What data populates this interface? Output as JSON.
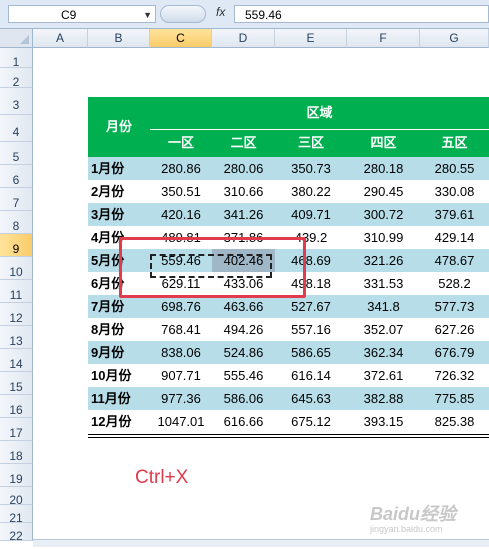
{
  "formula_bar": {
    "name_box": "C9",
    "fx_label": "fx",
    "formula": "559.46"
  },
  "columns": [
    "A",
    "B",
    "C",
    "D",
    "E",
    "F",
    "G"
  ],
  "rows": [
    "1",
    "2",
    "3",
    "4",
    "5",
    "6",
    "7",
    "8",
    "9",
    "10",
    "11",
    "12",
    "13",
    "14",
    "15",
    "16",
    "17",
    "18",
    "19",
    "20",
    "21",
    "22"
  ],
  "selected": {
    "column": "C",
    "row": "9"
  },
  "table": {
    "month_header": "月份",
    "region_header": "区域",
    "regions": [
      "一区",
      "二区",
      "三区",
      "四区",
      "五区"
    ],
    "data": [
      {
        "month": "1月份",
        "values": [
          "280.86",
          "280.06",
          "350.73",
          "280.18",
          "280.55"
        ]
      },
      {
        "month": "2月份",
        "values": [
          "350.51",
          "310.66",
          "380.22",
          "290.45",
          "330.08"
        ]
      },
      {
        "month": "3月份",
        "values": [
          "420.16",
          "341.26",
          "409.71",
          "300.72",
          "379.61"
        ]
      },
      {
        "month": "4月份",
        "values": [
          "489.81",
          "371.86",
          "439.2",
          "310.99",
          "429.14"
        ]
      },
      {
        "month": "5月份",
        "values": [
          "559.46",
          "402.46",
          "468.69",
          "321.26",
          "478.67"
        ]
      },
      {
        "month": "6月份",
        "values": [
          "629.11",
          "433.06",
          "498.18",
          "331.53",
          "528.2"
        ]
      },
      {
        "month": "7月份",
        "values": [
          "698.76",
          "463.66",
          "527.67",
          "341.8",
          "577.73"
        ]
      },
      {
        "month": "8月份",
        "values": [
          "768.41",
          "494.26",
          "557.16",
          "352.07",
          "627.26"
        ]
      },
      {
        "month": "9月份",
        "values": [
          "838.06",
          "524.86",
          "586.65",
          "362.34",
          "676.79"
        ]
      },
      {
        "month": "10月份",
        "values": [
          "907.71",
          "555.46",
          "616.14",
          "372.61",
          "726.32"
        ]
      },
      {
        "month": "11月份",
        "values": [
          "977.36",
          "586.06",
          "645.63",
          "382.88",
          "775.85"
        ]
      },
      {
        "month": "12月份",
        "values": [
          "1047.01",
          "616.66",
          "675.12",
          "393.15",
          "825.38"
        ]
      }
    ]
  },
  "annotation": "Ctrl+X",
  "watermark": {
    "brand": "Baidu经验",
    "url": "jingyan.baidu.com"
  },
  "colors": {
    "header_green": "#00b050",
    "band_teal": "#b6dde8",
    "highlight_red": "#e03c4b"
  }
}
